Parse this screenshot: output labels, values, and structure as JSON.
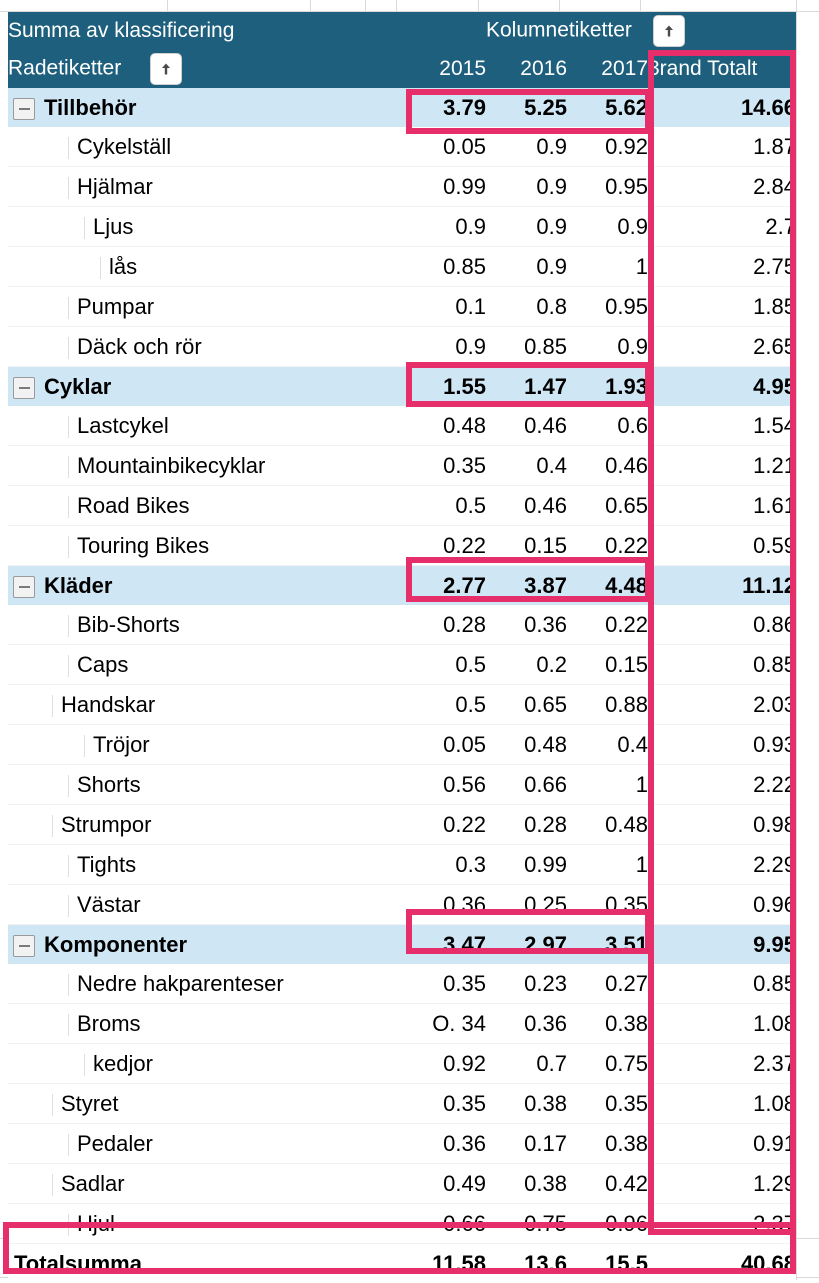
{
  "header": {
    "value_field": "Summa av klassificering",
    "column_labels": "Kolumnetiketter",
    "row_labels": "Radetiketter",
    "years": [
      "2015",
      "2016",
      "2017"
    ],
    "grand_total": "3rand Totalt",
    "filter_icon": "sort-arrow-up-icon",
    "header_bg": "#1d5f7c",
    "group_row_bg": "#cfe6f5",
    "annotation_color": "#e62e6b"
  },
  "rows": [
    {
      "type": "group",
      "label": "Tillbehör",
      "indent": 0,
      "values": [
        "3.79",
        "5.25",
        "5.62"
      ],
      "total": "14.66"
    },
    {
      "type": "leaf",
      "label": "Cykelställ",
      "indent": 2,
      "values": [
        "0.05",
        "0.9",
        "0.92"
      ],
      "total": "1.87"
    },
    {
      "type": "leaf",
      "label": "Hjälmar",
      "indent": 2,
      "values": [
        "0.99",
        "0.9",
        "0.95"
      ],
      "total": "2.84"
    },
    {
      "type": "leaf",
      "label": "Ljus",
      "indent": 3,
      "values": [
        "0.9",
        "0.9",
        "0.9"
      ],
      "total": "2.7"
    },
    {
      "type": "leaf",
      "label": "lås",
      "indent": 4,
      "values": [
        "0.85",
        "0.9",
        "1"
      ],
      "total": "2.75"
    },
    {
      "type": "leaf",
      "label": "Pumpar",
      "indent": 2,
      "values": [
        "0.1",
        "0.8",
        "0.95"
      ],
      "total": "1.85"
    },
    {
      "type": "leaf",
      "label": "Däck och rör",
      "indent": 2,
      "values": [
        "0.9",
        "0.85",
        "0.9"
      ],
      "total": "2.65"
    },
    {
      "type": "group",
      "label": "Cyklar",
      "indent": 0,
      "values": [
        "1.55",
        "1.47",
        "1.93"
      ],
      "total": "4.95"
    },
    {
      "type": "leaf",
      "label": "Lastcykel",
      "indent": 2,
      "values": [
        "0.48",
        "0.46",
        "0.6"
      ],
      "total": "1.54"
    },
    {
      "type": "leaf",
      "label": "Mountainbikecyklar",
      "indent": 2,
      "values": [
        "0.35",
        "0.4",
        "0.46"
      ],
      "total": "1.21"
    },
    {
      "type": "leaf",
      "label": "Road Bikes",
      "indent": 2,
      "values": [
        "0.5",
        "0.46",
        "0.65"
      ],
      "total": "1.61"
    },
    {
      "type": "leaf",
      "label": "Touring Bikes",
      "indent": 2,
      "values": [
        "0.22",
        "0.15",
        "0.22"
      ],
      "total": "0.59"
    },
    {
      "type": "group",
      "label": "Kläder",
      "indent": 0,
      "values": [
        "2.77",
        "3.87",
        "4.48"
      ],
      "total": "11.12"
    },
    {
      "type": "leaf",
      "label": "Bib-Shorts",
      "indent": 2,
      "values": [
        "0.28",
        "0.36",
        "0.22"
      ],
      "total": "0.86"
    },
    {
      "type": "leaf",
      "label": "Caps",
      "indent": 2,
      "values": [
        "0.5",
        "0.2",
        "0.15"
      ],
      "total": "0.85"
    },
    {
      "type": "leaf",
      "label": "Handskar",
      "indent": 1,
      "values": [
        "0.5",
        "0.65",
        "0.88"
      ],
      "total": "2.03"
    },
    {
      "type": "leaf",
      "label": "Tröjor",
      "indent": 3,
      "values": [
        "0.05",
        "0.48",
        "0.4"
      ],
      "total": "0.93"
    },
    {
      "type": "leaf",
      "label": "Shorts",
      "indent": 2,
      "values": [
        "0.56",
        "0.66",
        "1"
      ],
      "total": "2.22"
    },
    {
      "type": "leaf",
      "label": "Strumpor",
      "indent": 1,
      "values": [
        "0.22",
        "0.28",
        "0.48"
      ],
      "total": "0.98"
    },
    {
      "type": "leaf",
      "label": "Tights",
      "indent": 2,
      "values": [
        "0.3",
        "0.99",
        "1"
      ],
      "total": "2.29"
    },
    {
      "type": "leaf",
      "label": "Västar",
      "indent": 2,
      "values": [
        "0.36",
        "0.25",
        "0.35"
      ],
      "total": "0.96"
    },
    {
      "type": "group",
      "label": "Komponenter",
      "indent": 0,
      "values": [
        "3.47",
        "2.97",
        "3.51"
      ],
      "total": "9.95"
    },
    {
      "type": "leaf",
      "label": "Nedre hakparenteser",
      "indent": 2,
      "values": [
        "0.35",
        "0.23",
        "0.27"
      ],
      "total": "0.85"
    },
    {
      "type": "leaf",
      "label": "Broms",
      "indent": 2,
      "values": [
        "O. 34",
        "0.36",
        "0.38"
      ],
      "total": "1.08"
    },
    {
      "type": "leaf",
      "label": "kedjor",
      "indent": 3,
      "values": [
        "0.92",
        "0.7",
        "0.75"
      ],
      "total": "2.37"
    },
    {
      "type": "leaf",
      "label": "Styret",
      "indent": 1,
      "values": [
        "0.35",
        "0.38",
        "0.35"
      ],
      "total": "1.08"
    },
    {
      "type": "leaf",
      "label": "Pedaler",
      "indent": 2,
      "values": [
        "0.36",
        "0.17",
        "0.38"
      ],
      "total": "0.91"
    },
    {
      "type": "leaf",
      "label": "Sadlar",
      "indent": 1,
      "values": [
        "0.49",
        "0.38",
        "0.42"
      ],
      "total": "1.29"
    },
    {
      "type": "leaf",
      "label": "Hjul",
      "indent": 2,
      "values": [
        "0.66",
        "0.75",
        "0.96"
      ],
      "total": "2.37"
    },
    {
      "type": "total",
      "label": "Totalsumma",
      "indent": 0,
      "values": [
        "11.58",
        "13.6",
        "15.5"
      ],
      "total": "40.68"
    }
  ],
  "chart_data": {
    "type": "table",
    "title": "Summa av klassificering",
    "categories": [
      "2015",
      "2016",
      "2017",
      "3rand Totalt"
    ],
    "series": [
      {
        "name": "Tillbehör",
        "values": [
          3.79,
          5.25,
          5.62,
          14.66
        ]
      },
      {
        "name": "Cykelställ",
        "values": [
          0.05,
          0.9,
          0.92,
          1.87
        ]
      },
      {
        "name": "Hjälmar",
        "values": [
          0.99,
          0.9,
          0.95,
          2.84
        ]
      },
      {
        "name": "Ljus",
        "values": [
          0.9,
          0.9,
          0.9,
          2.7
        ]
      },
      {
        "name": "lås",
        "values": [
          0.85,
          0.9,
          1,
          2.75
        ]
      },
      {
        "name": "Pumpar",
        "values": [
          0.1,
          0.8,
          0.95,
          1.85
        ]
      },
      {
        "name": "Däck och rör",
        "values": [
          0.9,
          0.85,
          0.9,
          2.65
        ]
      },
      {
        "name": "Cyklar",
        "values": [
          1.55,
          1.47,
          1.93,
          4.95
        ]
      },
      {
        "name": "Lastcykel",
        "values": [
          0.48,
          0.46,
          0.6,
          1.54
        ]
      },
      {
        "name": "Mountainbikecyklar",
        "values": [
          0.35,
          0.4,
          0.46,
          1.21
        ]
      },
      {
        "name": "Road Bikes",
        "values": [
          0.5,
          0.46,
          0.65,
          1.61
        ]
      },
      {
        "name": "Touring Bikes",
        "values": [
          0.22,
          0.15,
          0.22,
          0.59
        ]
      },
      {
        "name": "Kläder",
        "values": [
          2.77,
          3.87,
          4.48,
          11.12
        ]
      },
      {
        "name": "Bib-Shorts",
        "values": [
          0.28,
          0.36,
          0.22,
          0.86
        ]
      },
      {
        "name": "Caps",
        "values": [
          0.5,
          0.2,
          0.15,
          0.85
        ]
      },
      {
        "name": "Handskar",
        "values": [
          0.5,
          0.65,
          0.88,
          2.03
        ]
      },
      {
        "name": "Tröjor",
        "values": [
          0.05,
          0.48,
          0.4,
          0.93
        ]
      },
      {
        "name": "Shorts",
        "values": [
          0.56,
          0.66,
          1,
          2.22
        ]
      },
      {
        "name": "Strumpor",
        "values": [
          0.22,
          0.28,
          0.48,
          0.98
        ]
      },
      {
        "name": "Tights",
        "values": [
          0.3,
          0.99,
          1,
          2.29
        ]
      },
      {
        "name": "Västar",
        "values": [
          0.36,
          0.25,
          0.35,
          0.96
        ]
      },
      {
        "name": "Komponenter",
        "values": [
          3.47,
          2.97,
          3.51,
          9.95
        ]
      },
      {
        "name": "Nedre hakparenteser",
        "values": [
          0.35,
          0.23,
          0.27,
          0.85
        ]
      },
      {
        "name": "Broms",
        "values": [
          0.34,
          0.36,
          0.38,
          1.08
        ]
      },
      {
        "name": "kedjor",
        "values": [
          0.92,
          0.7,
          0.75,
          2.37
        ]
      },
      {
        "name": "Styret",
        "values": [
          0.35,
          0.38,
          0.35,
          1.08
        ]
      },
      {
        "name": "Pedaler",
        "values": [
          0.36,
          0.17,
          0.38,
          0.91
        ]
      },
      {
        "name": "Sadlar",
        "values": [
          0.49,
          0.38,
          0.42,
          1.29
        ]
      },
      {
        "name": "Hjul",
        "values": [
          0.66,
          0.75,
          0.96,
          2.37
        ]
      },
      {
        "name": "Totalsumma",
        "values": [
          11.58,
          13.6,
          15.5,
          40.68
        ]
      }
    ],
    "xlabel": "",
    "ylabel": "",
    "legend": "none"
  }
}
